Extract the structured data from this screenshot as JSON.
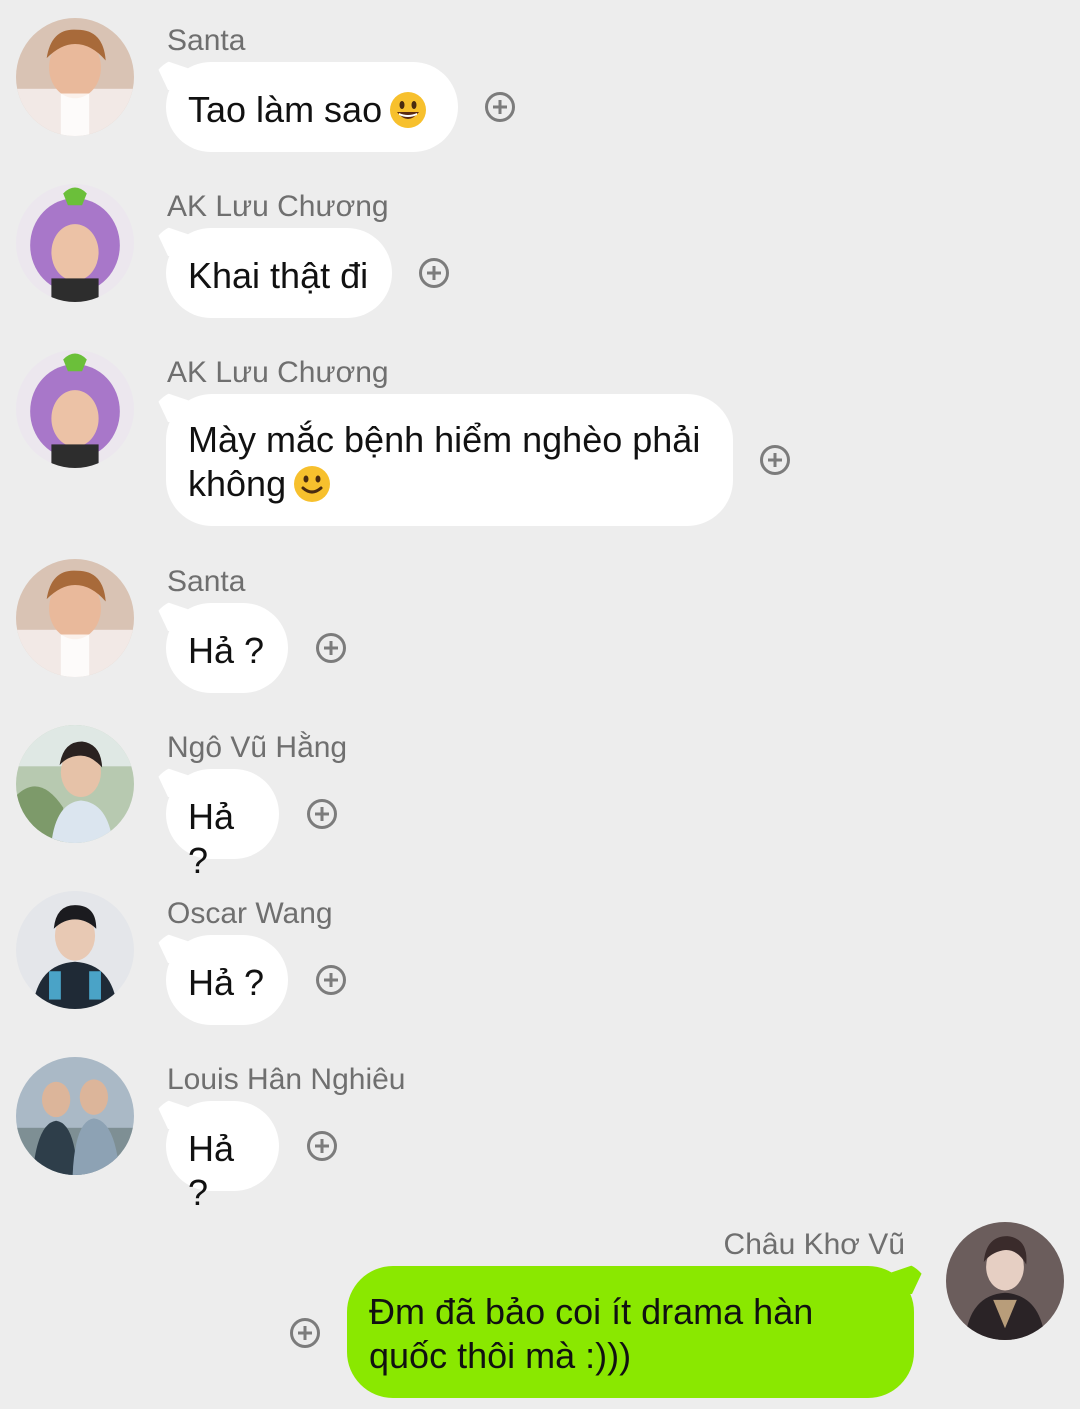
{
  "messages": [
    {
      "sender": "Santa",
      "text": "Tao làm sao",
      "emoji": "grinning-face-icon"
    },
    {
      "sender": "AK Lưu Chương",
      "text": "Khai thật đi"
    },
    {
      "sender": "AK Lưu Chương",
      "text_line1": "Mày mắc bệnh hiểm nghèo phải",
      "text_line2": "không",
      "emoji": "slightly-smiling-face-icon"
    },
    {
      "sender": "Santa",
      "text": "Hả ?"
    },
    {
      "sender": "Ngô Vũ Hằng",
      "text": "Hả ?"
    },
    {
      "sender": "Oscar Wang",
      "text": "Hả ?"
    },
    {
      "sender": "Louis Hân Nghiêu",
      "text": "Hả ?"
    },
    {
      "sender": "Châu Khơ Vũ",
      "text_line1": "Đm đã bảo coi ít drama hàn",
      "text_line2": "quốc thôi mà :)))"
    }
  ],
  "colors": {
    "background": "#ededed",
    "incoming_bubble": "#ffffff",
    "outgoing_bubble": "#8ae800",
    "sender_name": "#6f6f6f"
  }
}
